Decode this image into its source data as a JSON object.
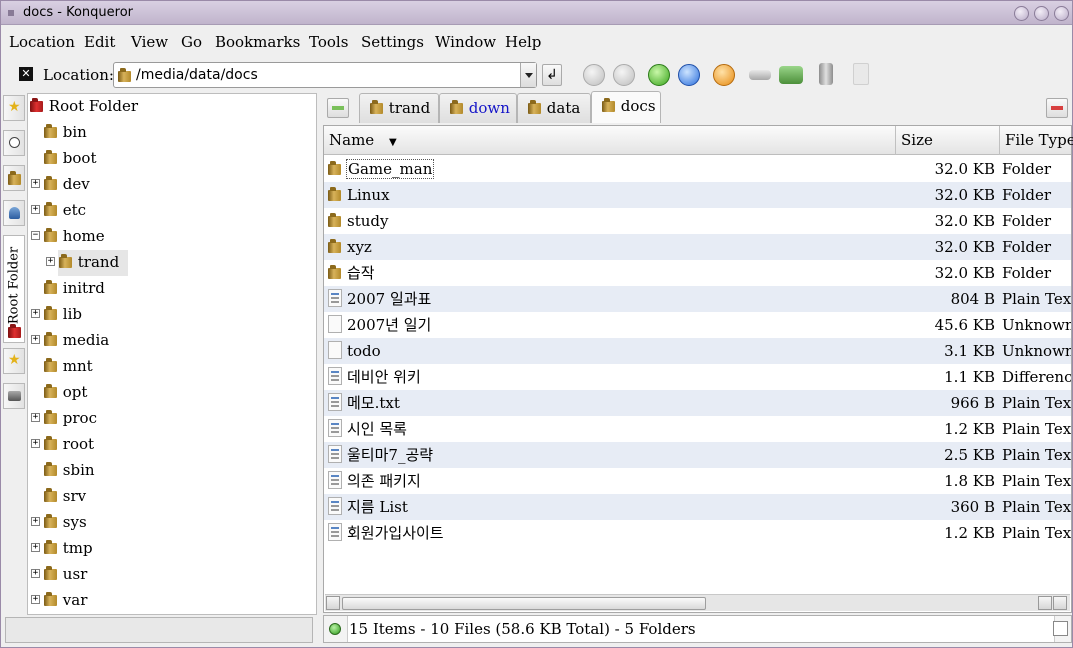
{
  "window": {
    "title": "docs - Konqueror"
  },
  "menu": [
    "Location",
    "Edit",
    "View",
    "Go",
    "Bookmarks",
    "Tools",
    "Settings",
    "Window",
    "Help"
  ],
  "location": {
    "label": "Location:",
    "value": "/media/data/docs"
  },
  "sidebar_tabs": {
    "root_folder": "Root Folder"
  },
  "tree": {
    "root": "Root Folder",
    "items": [
      "bin",
      "boot",
      "dev",
      "etc",
      "home",
      "trand",
      "initrd",
      "lib",
      "media",
      "mnt",
      "opt",
      "proc",
      "root",
      "sbin",
      "srv",
      "sys",
      "tmp",
      "usr",
      "var"
    ]
  },
  "tabs": [
    "trand",
    "down",
    "data",
    "docs"
  ],
  "columns": {
    "name": "Name",
    "size": "Size",
    "type": "File Type"
  },
  "files": [
    {
      "name": "Game_man",
      "size": "32.0 KB",
      "type": "Folder",
      "icon": "folder-icon"
    },
    {
      "name": "Linux",
      "size": "32.0 KB",
      "type": "Folder",
      "icon": "folder-icon"
    },
    {
      "name": "study",
      "size": "32.0 KB",
      "type": "Folder",
      "icon": "folder-icon"
    },
    {
      "name": "xyz",
      "size": "32.0 KB",
      "type": "Folder",
      "icon": "folder-icon"
    },
    {
      "name": "습작",
      "size": "32.0 KB",
      "type": "Folder",
      "icon": "folder-icon"
    },
    {
      "name": "2007 일과표",
      "size": "804 B",
      "type": "Plain Text",
      "icon": "text-file-icon"
    },
    {
      "name": "2007년 일기",
      "size": "45.6 KB",
      "type": "Unknown",
      "icon": "unknown-file-icon"
    },
    {
      "name": "todo",
      "size": "3.1 KB",
      "type": "Unknown",
      "icon": "unknown-file-icon"
    },
    {
      "name": "데비안 위키",
      "size": "1.1 KB",
      "type": "Difference",
      "icon": "text-file-icon"
    },
    {
      "name": "메모.txt",
      "size": "966 B",
      "type": "Plain Text",
      "icon": "text-file-icon"
    },
    {
      "name": "시인 목록",
      "size": "1.2 KB",
      "type": "Plain Text",
      "icon": "text-file-icon"
    },
    {
      "name": "울티마7_공략",
      "size": "2.5 KB",
      "type": "Plain Text",
      "icon": "text-file-icon"
    },
    {
      "name": "의존 패키지",
      "size": "1.8 KB",
      "type": "Plain Text",
      "icon": "text-file-icon"
    },
    {
      "name": "지름 List",
      "size": "360 B",
      "type": "Plain Text",
      "icon": "text-file-icon"
    },
    {
      "name": "회원가입사이트",
      "size": "1.2 KB",
      "type": "Plain Text",
      "icon": "text-file-icon"
    }
  ],
  "status": {
    "text": "15 Items - 10 Files (58.6 KB Total) - 5 Folders"
  },
  "colors": {
    "title_bar": "#c8bcd4",
    "row_alt": "#e7ecf5",
    "tab_link": "#1515c8",
    "root_folder_red": "#c02020"
  }
}
